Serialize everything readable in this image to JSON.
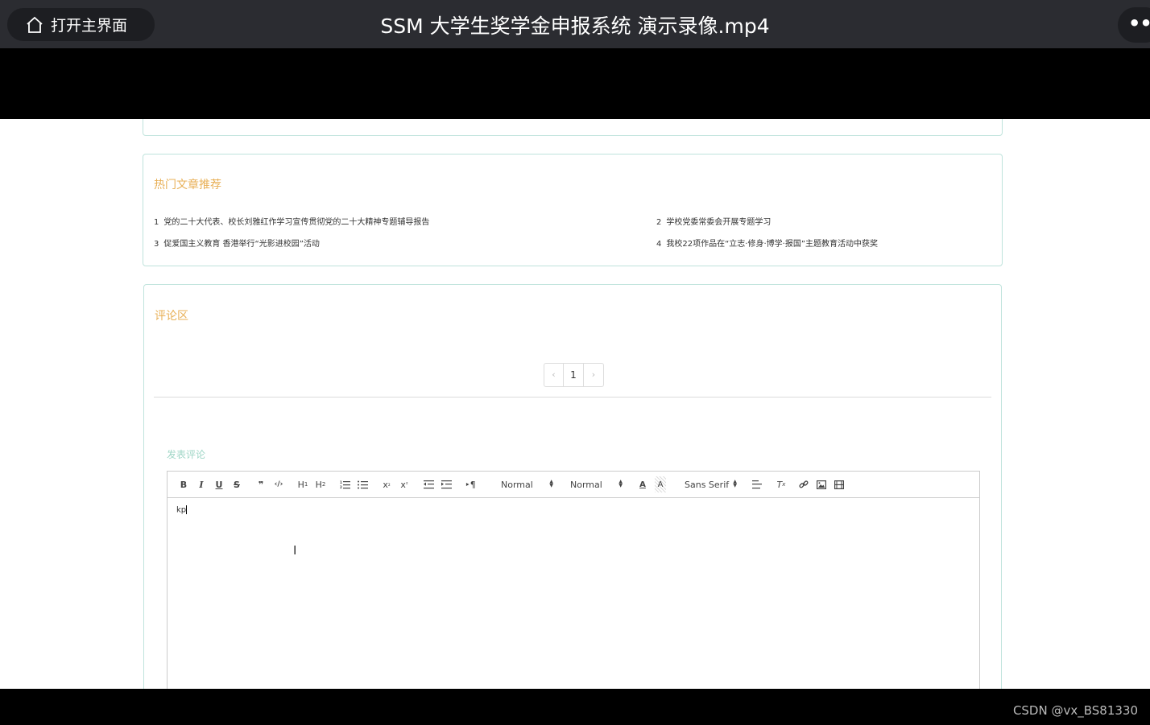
{
  "player": {
    "home_label": "打开主界面",
    "title": "SSM 大学生奖学金申报系统 演示录像.mp4",
    "more_label": "•••"
  },
  "hot_articles": {
    "title": "热门文章推荐",
    "items": [
      {
        "num": "1",
        "text": "党的二十大代表、校长刘雅红作学习宣传贯彻党的二十大精神专题辅导报告"
      },
      {
        "num": "2",
        "text": "学校党委常委会开展专题学习"
      },
      {
        "num": "3",
        "text": "促爱国主义教育 香港举行“光影进校园”活动"
      },
      {
        "num": "4",
        "text": "我校22项作品在“立志·修身·博学·报国”主题教育活动中获奖"
      }
    ]
  },
  "comments": {
    "title": "评论区",
    "pager": {
      "prev": "‹",
      "current": "1",
      "next": "›"
    },
    "post_label": "发表评论",
    "toolbar": {
      "header_picker": "Normal",
      "size_picker": "Normal",
      "font_picker": "Sans Serif"
    },
    "editor_text": "kp"
  },
  "watermark": "CSDN @vx_BS81330"
}
